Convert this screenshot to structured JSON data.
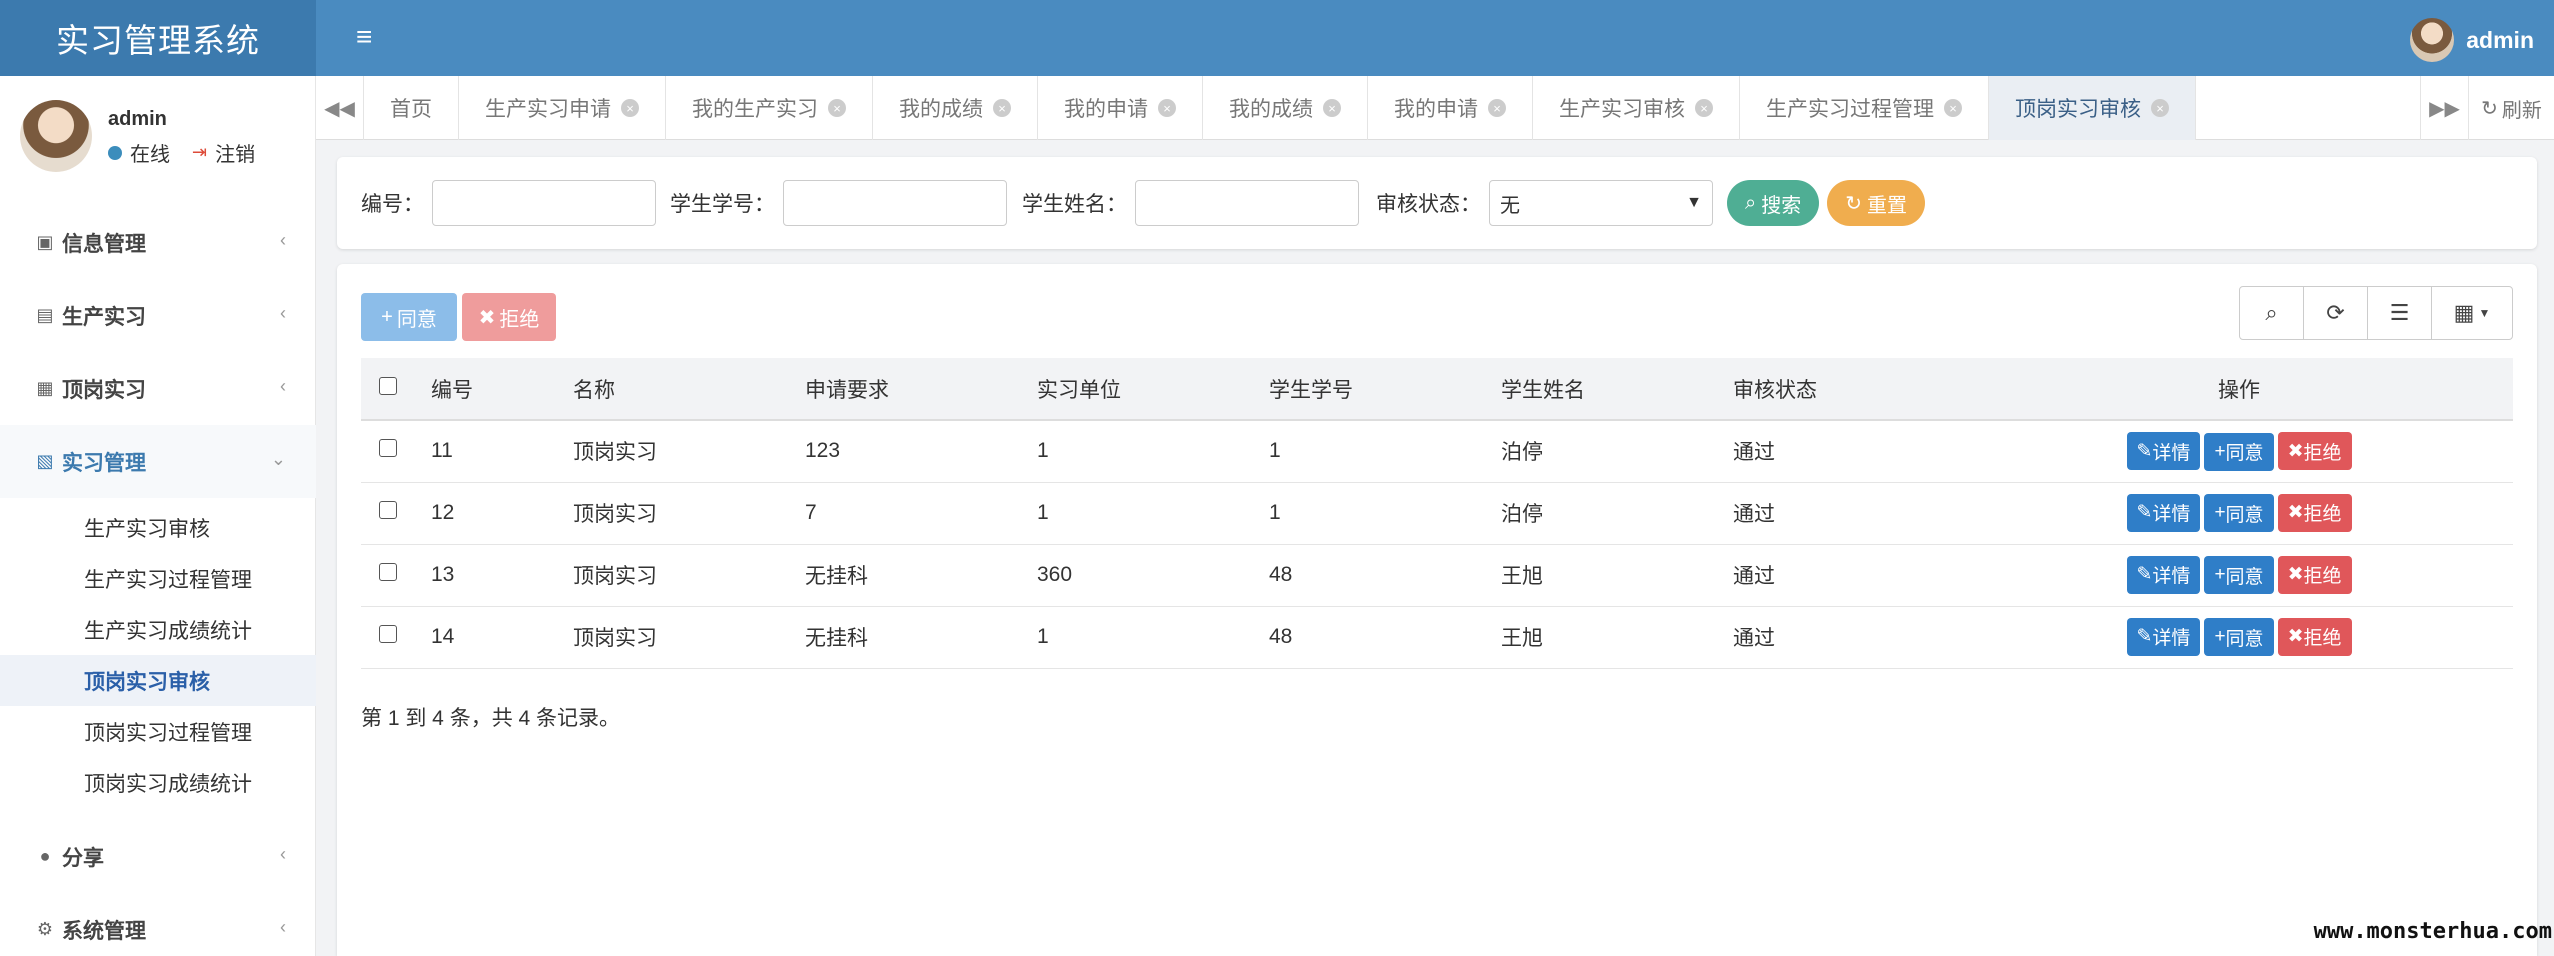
{
  "header": {
    "app_title": "实习管理系统",
    "user_name": "admin"
  },
  "profile": {
    "name": "admin",
    "status": "在线",
    "logout": "注销"
  },
  "sidebar": {
    "items": [
      {
        "label": "信息管理",
        "icon": "id-card-icon"
      },
      {
        "label": "生产实习",
        "icon": "id-badge-icon"
      },
      {
        "label": "顶岗实习",
        "icon": "id-card-icon"
      },
      {
        "label": "实习管理",
        "icon": "address-card-icon"
      },
      {
        "label": "分享",
        "icon": "comment-icon"
      },
      {
        "label": "系统管理",
        "icon": "gear-icon"
      }
    ],
    "submenu": [
      "生产实习审核",
      "生产实习过程管理",
      "生产实习成绩统计",
      "顶岗实习审核",
      "顶岗实习过程管理",
      "顶岗实习成绩统计"
    ]
  },
  "tabs": [
    "首页",
    "生产实习申请",
    "我的生产实习",
    "我的成绩",
    "我的申请",
    "我的成绩",
    "我的申请",
    "生产实习审核",
    "生产实习过程管理",
    "顶岗实习审核"
  ],
  "tabs_refresh": "刷新",
  "search": {
    "id_label": "编号：",
    "student_no_label": "学生学号：",
    "student_name_label": "学生姓名：",
    "status_label": "审核状态：",
    "status_value": "无",
    "search_button": "搜索",
    "reset_button": "重置"
  },
  "toolbar": {
    "agree_label": "同意",
    "reject_label": "拒绝"
  },
  "table": {
    "columns": [
      "编号",
      "名称",
      "申请要求",
      "实习单位",
      "学生学号",
      "学生姓名",
      "审核状态",
      "操作"
    ],
    "rows": [
      [
        "11",
        "顶岗实习",
        "123",
        "1",
        "1",
        "泊停",
        "通过"
      ],
      [
        "12",
        "顶岗实习",
        "7",
        "1",
        "1",
        "泊停",
        "通过"
      ],
      [
        "13",
        "顶岗实习",
        "无挂科",
        "360",
        "48",
        "王旭",
        "通过"
      ],
      [
        "14",
        "顶岗实习",
        "无挂科",
        "1",
        "48",
        "王旭",
        "通过"
      ]
    ],
    "actions": {
      "detail": "详情",
      "agree": "同意",
      "reject": "拒绝"
    }
  },
  "pager_info": "第 1 到 4 条，共 4 条记录。",
  "watermark": "www.monsterhua.com",
  "colors": {
    "header": "#4a8bc0",
    "logo_bg": "#3c7aae",
    "accent": "#2f7ec8",
    "danger": "#e0575a",
    "success": "#4fae94",
    "warning": "#f0ad4e"
  }
}
